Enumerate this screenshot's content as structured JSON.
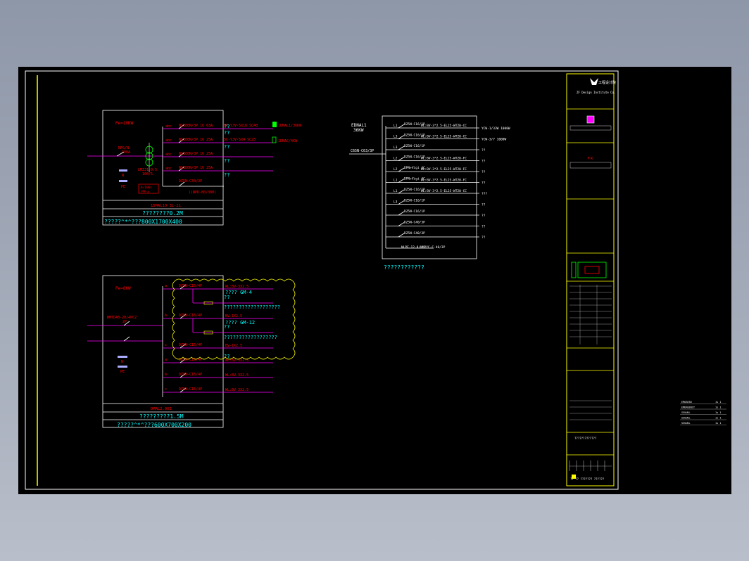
{
  "colors": {
    "background": "#000000",
    "frame": "#ffffff",
    "yellow": "#ffff00",
    "magenta": "#ff00ff",
    "red": "#ff0000",
    "cyan": "#00ffff",
    "green": "#00ff00"
  },
  "panel1": {
    "power": "Pe=10KW",
    "breaker": "NFG/N\n100A",
    "ct": "LMZJ1-0.5\n100/5",
    "meter": "A(100)\nPM-x",
    "n_label": "N",
    "pe_label": "PE",
    "out_left": [
      "abc",
      "abc",
      "abc",
      "abc"
    ],
    "out_breakers": [
      "NS100N/3P 1U 63A",
      "NS100N/3P 1U 25A",
      "NS100N/3P 1U 25A",
      "NS100N/3P 1U 25A"
    ],
    "spd": "DZ5N-C40/3P",
    "spd_right": "((NPD-80/380)",
    "out_cables": [
      "NH-YJV-5X16 SC40",
      "SC-YJV-5X4 SC25",
      "",
      ""
    ],
    "qq": [
      "??",
      "??",
      "??",
      "??"
    ],
    "dest1": "1DMAL1/36KW",
    "dest2": "1DMAC/4KW",
    "box_title": "1DMAL10 3L-21",
    "box_size": "????????0.2M",
    "box_dims": "?????^*^???800X1700X400"
  },
  "panel2": {
    "power": "Pe=8KW",
    "breaker": "NMTD4B-20/4PC2\n2P",
    "n_label": "N",
    "pe_label": "PE",
    "phases": [
      "a",
      "b",
      "c",
      "a",
      "b",
      "c"
    ],
    "breakers": [
      "DZ5N-C16/4P",
      "DZ5N-C16/4P",
      "DZ5N-C16/4P",
      "DZ5N-C16/4P",
      "DZ5N-C16/4P",
      "DZ5N-C16/4P"
    ],
    "rows": [
      "WL:BV-3X2.5",
      "BV-1X2.5",
      "BV-1X2.5",
      "WL:BV-3X2.5",
      "WL:BV-3X2.5",
      "WL:BV-3X2.5"
    ],
    "gm1": "???? GM-4",
    "gm2": "???? GM-12",
    "qline1": "???????????????????",
    "qline2": "??????????????????",
    "qq": [
      "??",
      "??",
      "??"
    ],
    "box_title": "DMAL2.0X3",
    "box_size": "?????????1.5M",
    "box_dims": "?????^*^???600X700X200"
  },
  "panel3": {
    "title": "EDNAL1\n36KW",
    "incoming": "C65N-C63/3P",
    "phases": [
      "L1",
      "L3",
      "L3",
      "L2",
      "L2",
      "L1",
      "L1",
      "L3",
      "",
      "",
      ""
    ],
    "breakers": [
      "DZ5N-C16/1P",
      "DZ5N-C16/1P",
      "DZ5N-C16/1P",
      "DZ5N-C16/1P",
      "DPN+Vigi 4C",
      "DPN+Vigi 4C",
      "DZ5N-C16/1P",
      "DZ5N-C16/1P",
      "DZ5N-C16/1P",
      "DZ5N-C40/3P",
      "DZ5N-C40/3P"
    ],
    "cables": [
      "WL:BV-3*2.5-EL25-WT20-CC",
      "WL:BV-3*2.5-EL25-WT20-CC",
      "",
      "WL:BV-3*2.5-EL25-WT20-FC",
      "WL:BV-3*2.5-EL25-WT20-FC",
      "WL:BV-3*2.5-EL25-WT20-FC",
      "WL:BV-3*2.5-EL25-WT20-CC",
      "",
      "",
      "",
      ""
    ],
    "ends": [
      "YCW-1/33W 1000W",
      "YCW-3/7 1000W",
      "??",
      "??",
      "??",
      "??",
      "???",
      "??",
      "??",
      "??",
      "??"
    ],
    "spd": "NLPE-12.8/NMPYC-C-40/3P",
    "caption": "????????????"
  },
  "title_block": {
    "logo_text": "工程设计院",
    "company": "ZF Design Institute Co.",
    "rows": [
      "??",
      "??",
      "??",
      "??",
      "??",
      "??",
      "??"
    ],
    "bottom_text": "?? ?? ??????? ??????",
    "project": "?????????????"
  },
  "side_table": {
    "rows": [
      [
        "EMOSE60",
        "1s 1"
      ],
      [
        "EMERGENCY",
        "1s 1"
      ],
      [
        "SSUUUL",
        "1s 1"
      ],
      [
        "SSUUUL",
        "1s 1"
      ],
      [
        "SSUUUL",
        "1s 1"
      ]
    ]
  }
}
